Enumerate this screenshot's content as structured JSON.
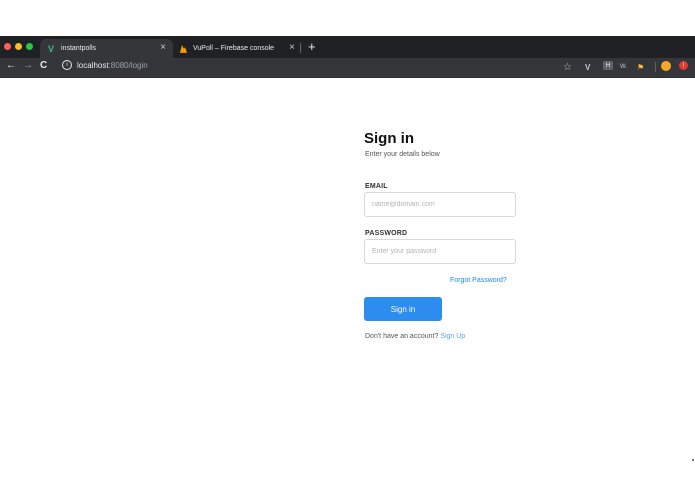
{
  "browser": {
    "tabs": [
      {
        "title": "instantpolls",
        "icon": "vue-logo-icon",
        "active": true
      },
      {
        "title": "VuPoll – Firebase console",
        "icon": "firebase-icon",
        "active": false
      }
    ],
    "tab_close_glyph": "×",
    "new_tab_glyph": "+",
    "url_host": "localhost",
    "url_path": ":8080/login",
    "colors": {
      "tabbar": "#202124",
      "active_tab": "#35363a",
      "close": "#ff5f57",
      "minimize": "#ffbd2e",
      "maximize": "#28c840"
    }
  },
  "login": {
    "title": "Sign in",
    "subtitle": "Enter your details below",
    "email_label": "EMAIL",
    "email_placeholder": "name@domain.com",
    "password_label": "PASSWORD",
    "password_placeholder": "Enter your password",
    "forgot_label": "Forgot Password?",
    "submit_label": "Sign in",
    "footer_text": "Don't have an account?",
    "signup_label": "Sign Up",
    "colors": {
      "primary": "#2d8cf0",
      "link": "#1e88e5"
    }
  }
}
